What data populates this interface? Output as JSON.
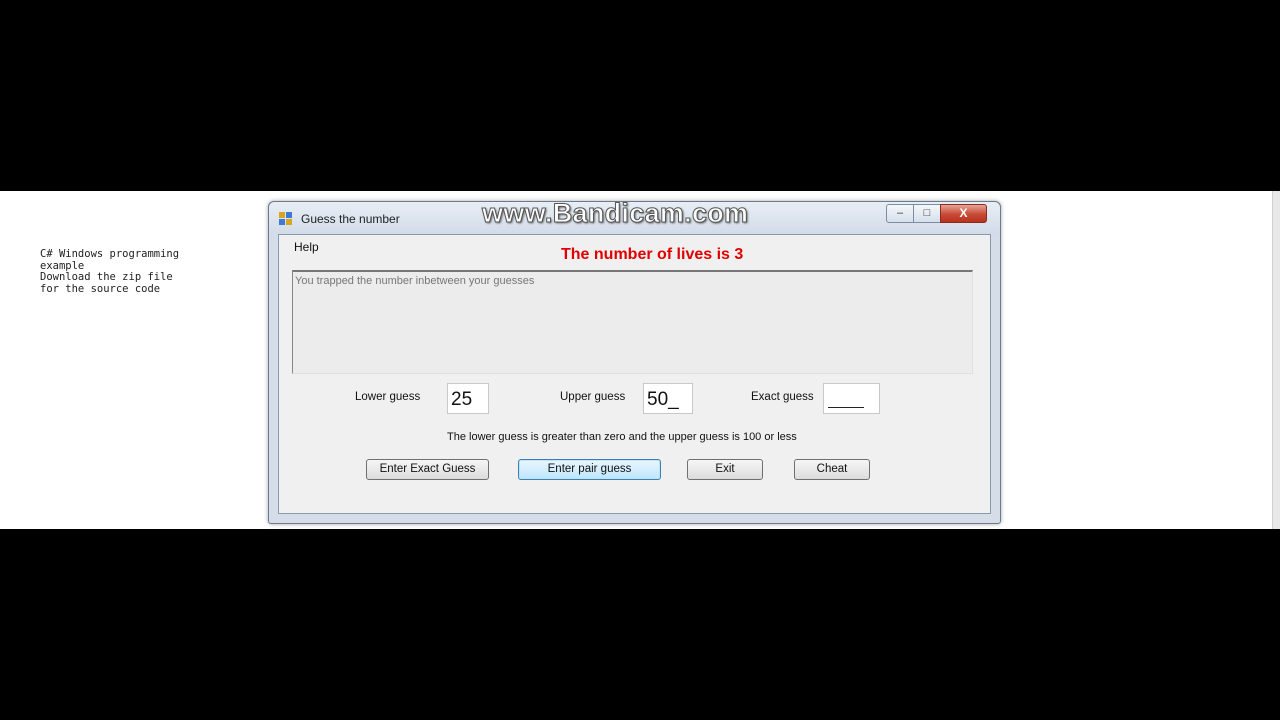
{
  "side_note": "C# Windows programming\nexample\nDownload the zip file\nfor the source code",
  "window": {
    "title": "Guess the number",
    "watermark": "www.Bandicam.com",
    "controls": {
      "minimize": "–",
      "maximize": "□",
      "close": "X"
    },
    "icon": "app-window-icon"
  },
  "menu": {
    "help": "Help"
  },
  "status": {
    "lives": "The number of lives is 3"
  },
  "message": {
    "text": "You trapped the number inbetween your guesses"
  },
  "inputs": {
    "lower": {
      "label": "Lower guess",
      "value": "25"
    },
    "upper": {
      "label": "Upper guess",
      "value": "50_"
    },
    "exact": {
      "label": "Exact guess",
      "value": ""
    }
  },
  "hint": "The lower guess is greater than zero and the upper guess is 100 or less",
  "buttons": {
    "exact": "Enter Exact Guess",
    "pair": "Enter pair guess",
    "exit": "Exit",
    "cheat": "Cheat"
  },
  "colors": {
    "lives_text": "#e00000",
    "focus_button": "#3c7fb1",
    "close_button": "#c74a36"
  }
}
